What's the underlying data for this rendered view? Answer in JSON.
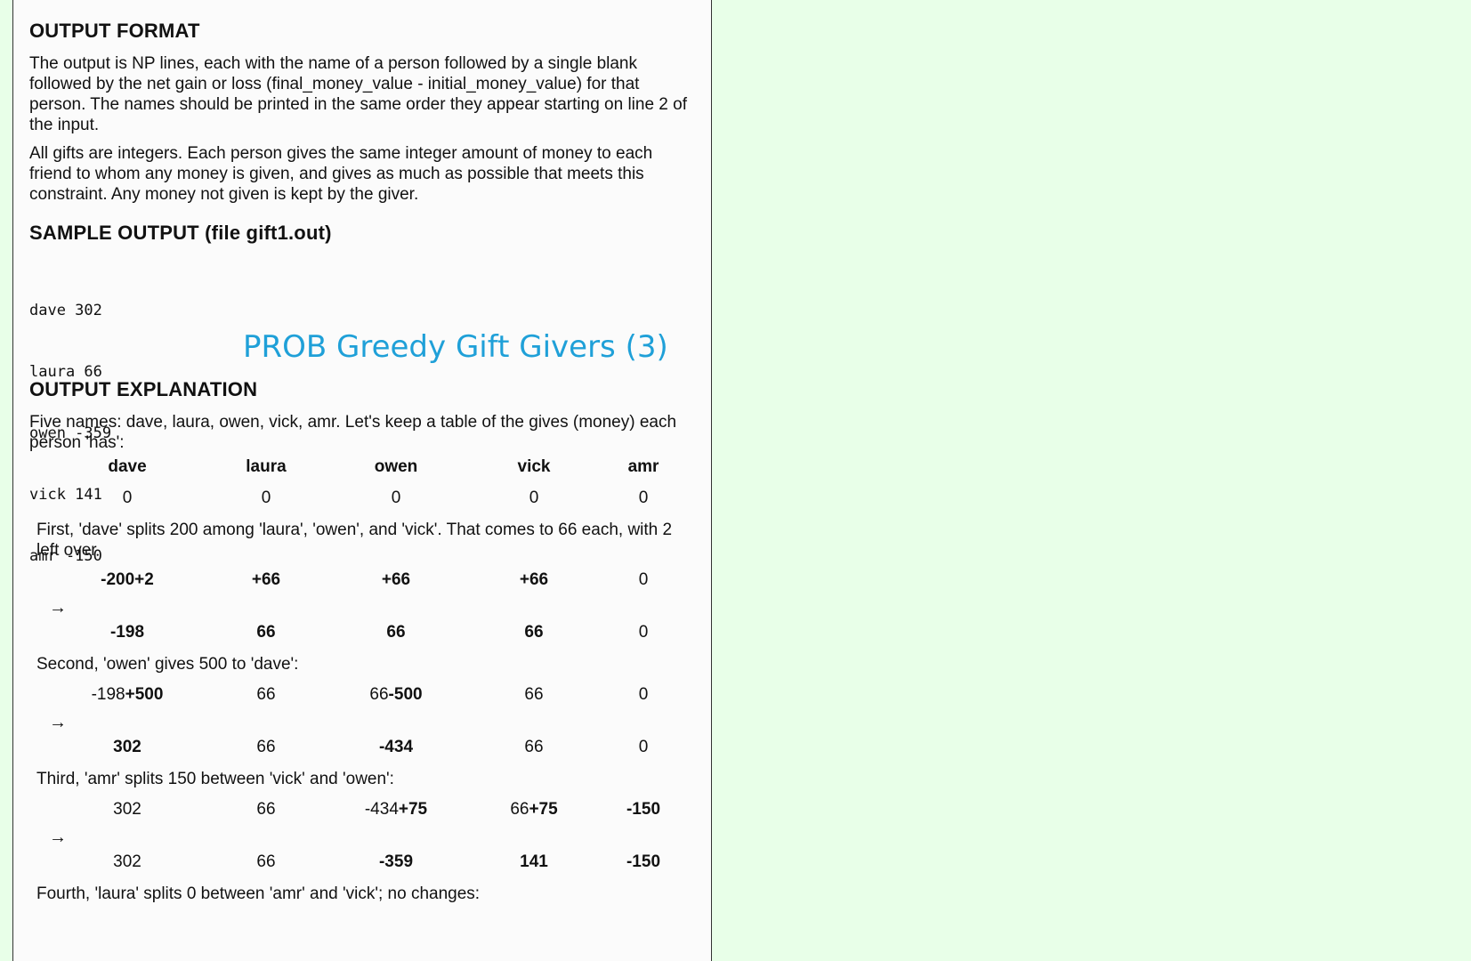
{
  "output_format": {
    "heading": "OUTPUT FORMAT",
    "para1": "The output is NP lines, each with the name of a person followed by a single blank followed by the net gain or loss (final_money_value - initial_money_value) for that person. The names should be printed in the same order they appear starting on line 2 of the input.",
    "para2": "All gifts are integers. Each person gives the same integer amount of money to each friend to whom any money is given, and gives as much as possible that meets this constraint. Any money not given is kept by the giver."
  },
  "sample_output": {
    "heading": "SAMPLE OUTPUT (file gift1.out)",
    "lines": [
      "dave 302",
      "laura 66",
      "owen -359",
      "vick 141",
      "amr -150"
    ]
  },
  "overlay_title": "PROB Greedy Gift Givers (3)",
  "explanation": {
    "heading": "OUTPUT EXPLANATION",
    "intro": "Five names: dave, laura, owen, vick, amr. Let's keep a table of the gives (money) each person 'has':",
    "names": [
      "dave",
      "laura",
      "owen",
      "vick",
      "amr"
    ],
    "initial": [
      "0",
      "0",
      "0",
      "0",
      "0"
    ],
    "arrow": "→",
    "step1": {
      "text": "First, 'dave' splits 200 among 'laura', 'owen', and 'vick'. That comes to 66 each, with 2 left over",
      "change": [
        "-200+2",
        "+66",
        "+66",
        "+66",
        "0"
      ],
      "result": [
        "-198",
        "66",
        "66",
        "66",
        "0"
      ]
    },
    "step2": {
      "text": "Second, 'owen' gives 500 to 'dave':",
      "change_plain": [
        "-198",
        "66",
        "66",
        "66",
        "0"
      ],
      "change_bold": [
        "+500",
        "",
        "-500",
        "",
        ""
      ],
      "result": [
        "302",
        "66",
        "-434",
        "66",
        "0"
      ]
    },
    "step3": {
      "text": "Third, 'amr' splits 150 between 'vick' and 'owen':",
      "change_plain": [
        "302",
        "66",
        "-434",
        "66",
        ""
      ],
      "change_bold": [
        "",
        "",
        "+75",
        "+75",
        "-150"
      ],
      "result": [
        "302",
        "66",
        "-359",
        "141",
        "-150"
      ]
    },
    "step4": {
      "text": "Fourth, 'laura' splits 0 between 'amr' and 'vick'; no changes:"
    }
  }
}
